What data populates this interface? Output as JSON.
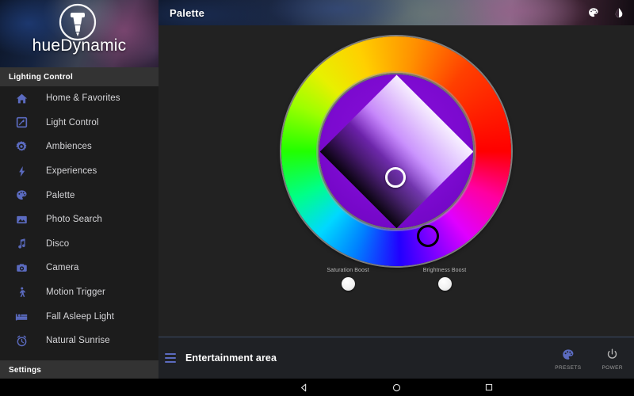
{
  "app": {
    "brand": "hueDynamic",
    "logo_icon": "light-bulb-icon"
  },
  "sidebar": {
    "sections": {
      "lighting_control": "Lighting Control",
      "settings": "Settings"
    },
    "items": [
      {
        "label": "Home & Favorites",
        "icon": "home-icon"
      },
      {
        "label": "Light Control",
        "icon": "light-control-icon"
      },
      {
        "label": "Ambiences",
        "icon": "gear-icon"
      },
      {
        "label": "Experiences",
        "icon": "bolt-icon"
      },
      {
        "label": "Palette",
        "icon": "palette-icon"
      },
      {
        "label": "Photo Search",
        "icon": "photo-icon"
      },
      {
        "label": "Disco",
        "icon": "music-note-icon"
      },
      {
        "label": "Camera",
        "icon": "camera-icon"
      },
      {
        "label": "Motion Trigger",
        "icon": "walking-person-icon"
      },
      {
        "label": "Fall Asleep Light",
        "icon": "bed-icon"
      },
      {
        "label": "Natural Sunrise",
        "icon": "alarm-clock-icon"
      }
    ]
  },
  "appbar": {
    "title": "Palette",
    "actions": [
      {
        "name": "palette-icon",
        "label": "Palette"
      },
      {
        "name": "brightness-contrast-icon",
        "label": "Brightness"
      }
    ]
  },
  "palette": {
    "wheel": {
      "type": "hsv-color-wheel",
      "hue_ring_label": "Hue ring",
      "sv_area_label": "Saturation / Value diamond",
      "selected_hue_color": "#8a0fd8",
      "selected_sv_color": "#7b1fd8",
      "hue_thumb_color": "#000000",
      "sv_thumb_color": "#ffffff"
    },
    "boosts": [
      {
        "label": "Saturation Boost",
        "state": "off"
      },
      {
        "label": "Brightness Boost",
        "state": "off"
      }
    ]
  },
  "group_bar": {
    "menu_icon": "hamburger-icon",
    "title": "Entertainment area",
    "actions": [
      {
        "label": "PRESETS",
        "icon": "palette-icon",
        "color": "#5b6bc0"
      },
      {
        "label": "POWER",
        "icon": "power-icon",
        "color": "#b8b8b8"
      }
    ]
  },
  "navbar": {
    "buttons": [
      {
        "name": "back-icon",
        "label": "Back"
      },
      {
        "name": "home-icon",
        "label": "Home"
      },
      {
        "name": "recents-icon",
        "label": "Recents"
      }
    ]
  }
}
